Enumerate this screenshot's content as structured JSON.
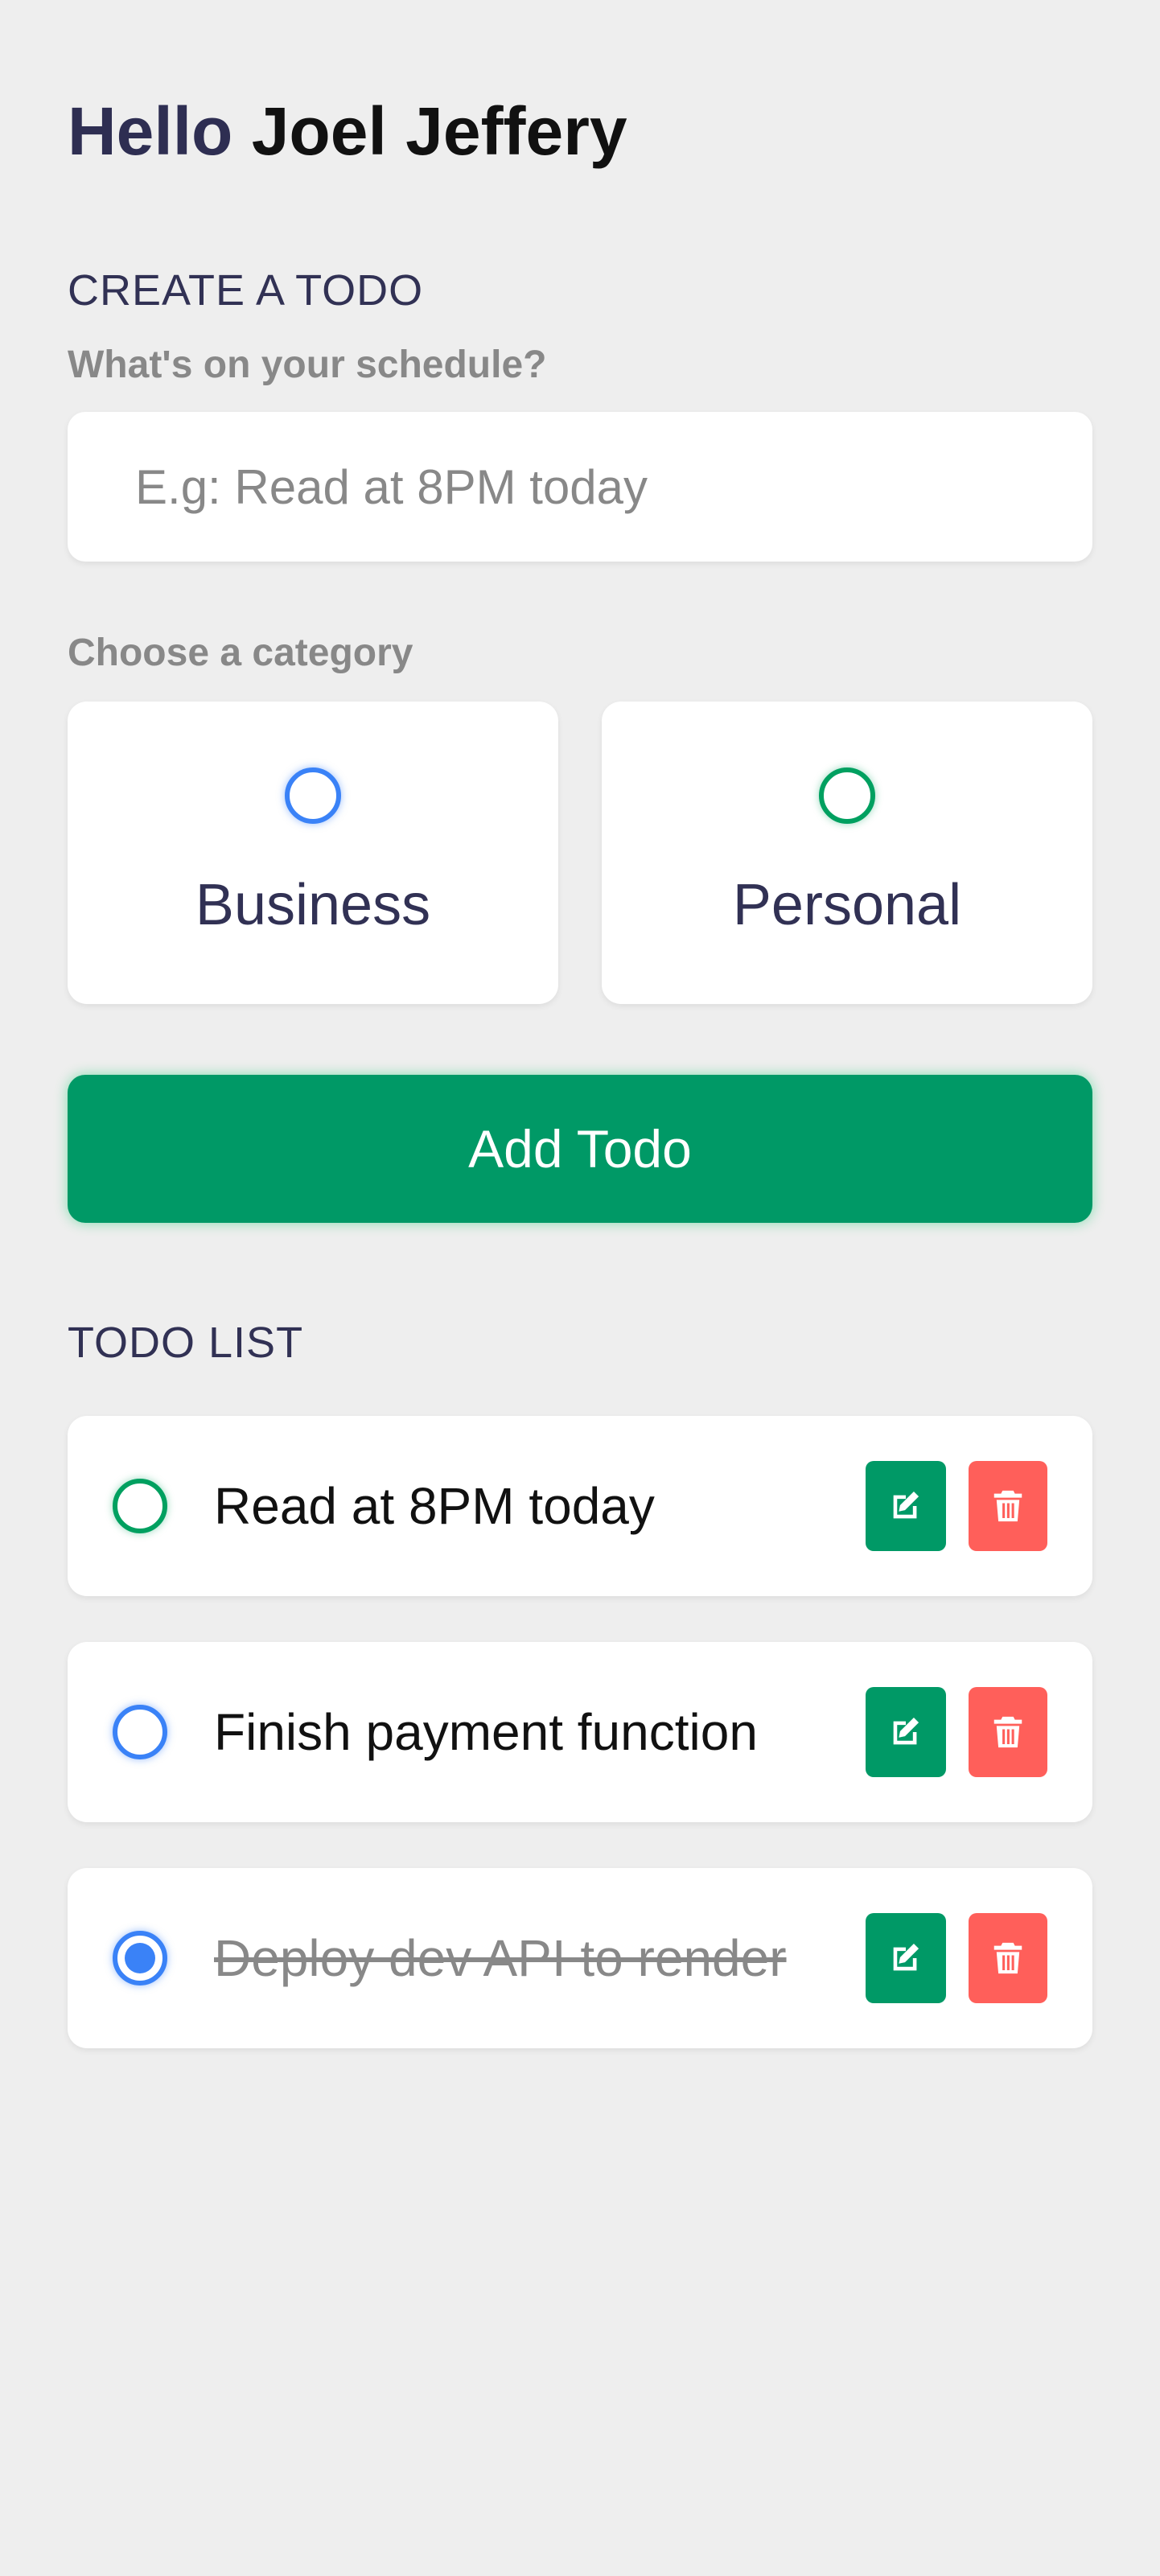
{
  "greeting": {
    "hello": "Hello",
    "name": "Joel Jeffery"
  },
  "create": {
    "title": "CREATE A TODO",
    "question": "What's on your schedule?",
    "input_placeholder": "E.g: Read at 8PM today",
    "input_value": "",
    "category_label": "Choose a category",
    "categories": [
      {
        "label": "Business",
        "color": "#3a82f7"
      },
      {
        "label": "Personal",
        "color": "#00a060"
      }
    ],
    "add_button": "Add Todo"
  },
  "list": {
    "title": "TODO LIST",
    "todos": [
      {
        "text": "Read at 8PM today",
        "category": "personal",
        "done": false
      },
      {
        "text": "Finish payment function",
        "category": "business",
        "done": false
      },
      {
        "text": "Deploy dev API to render",
        "category": "business",
        "done": true
      }
    ]
  },
  "colors": {
    "background": "#eeeeee",
    "primary_green": "#009966",
    "delete_red": "#ff5f5a",
    "business_blue": "#3a82f7",
    "heading": "#313154",
    "muted": "#888888"
  },
  "icons": {
    "edit": "pencil-square-icon",
    "delete": "trash-icon"
  }
}
